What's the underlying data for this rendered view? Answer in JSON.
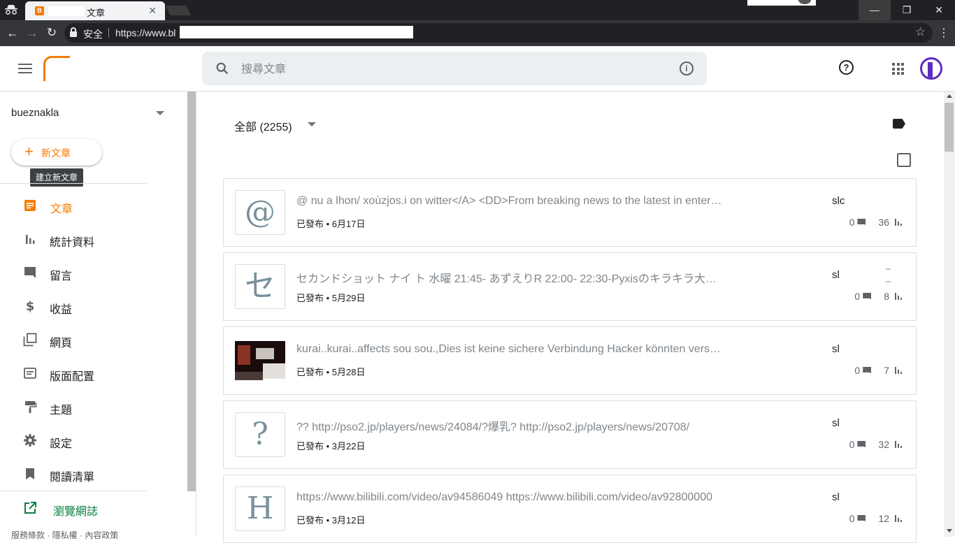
{
  "browser": {
    "tab_title": "文章",
    "secure_label": "安全",
    "url": "https://www.bl"
  },
  "header": {
    "search_placeholder": "搜尋文章"
  },
  "sidebar": {
    "blog_name": "bueznakla",
    "new_post_label": "新文章",
    "new_post_tooltip": "建立新文章",
    "items": [
      {
        "label": "文章",
        "icon": "posts-icon",
        "active": true
      },
      {
        "label": "統計資料",
        "icon": "stats-icon"
      },
      {
        "label": "留言",
        "icon": "comments-icon"
      },
      {
        "label": "收益",
        "icon": "dollar-icon"
      },
      {
        "label": "網頁",
        "icon": "pages-icon"
      },
      {
        "label": "版面配置",
        "icon": "layout-icon"
      },
      {
        "label": "主題",
        "icon": "theme-icon"
      },
      {
        "label": "設定",
        "icon": "gear-icon"
      },
      {
        "label": "閱讀清單",
        "icon": "bookmark-icon"
      }
    ],
    "view_blog_label": "瀏覽網誌",
    "footer": "服務條款 · 隱私權 · 內容政策"
  },
  "main": {
    "filter_label": "全部 (2255)",
    "posts": [
      {
        "thumb": "@",
        "title": "@ nu a lhon/ xoùzjos.i on witter</A> <DD>From breaking news to the latest in entertainment",
        "meta": "已發布 • 6月17日",
        "author": "slc",
        "comments": "0",
        "views": "36"
      },
      {
        "thumb": "セ",
        "title": "セカンドショット ナイ ト 水曜 21:45- あずえりR 22:00- 22:30-Pyxisのキラキラ大作戦",
        "meta": "已發布 • 5月29日",
        "author": "sl",
        "comments": "0",
        "views": "8"
      },
      {
        "thumb": "",
        "title": "kurai..kurai..affects sou sou.,Dies ist keine sichere Verbindung Hacker könnten versuchen",
        "meta": "已發布 • 5月28日",
        "author": "sl",
        "comments": "0",
        "views": "7"
      },
      {
        "thumb": "?",
        "title": "?? http://pso2.jp/players/news/24084/?爆乳? http://pso2.jp/players/news/20708/",
        "meta": "已發布 • 3月22日",
        "author": "sl",
        "comments": "0",
        "views": "32"
      },
      {
        "thumb": "H",
        "title": "https://www.bilibili.com/video/av94586049 https://www.bilibili.com/video/av92800000",
        "meta": "已發布 • 3月12日",
        "author": "sl",
        "comments": "0",
        "views": "12"
      }
    ]
  },
  "colors": {
    "accent": "#f57c00",
    "view_blog": "#0b8043"
  }
}
